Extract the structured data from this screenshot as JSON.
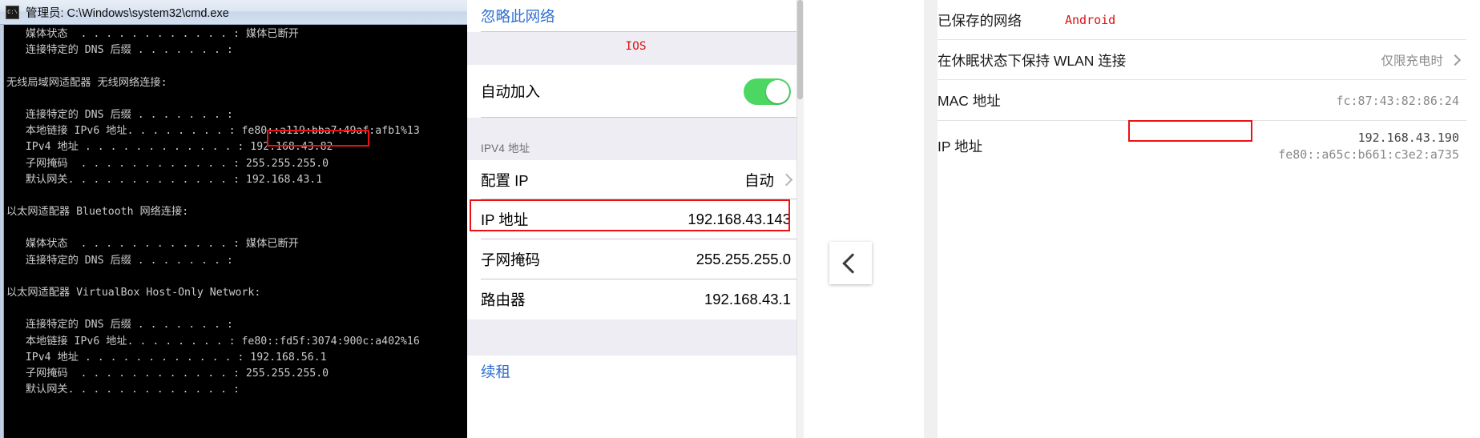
{
  "cmd": {
    "icon_label": "C:\\",
    "title": "管理员: C:\\Windows\\system32\\cmd.exe",
    "lines": [
      "   媒体状态  . . . . . . . . . . . . : 媒体已断开",
      "   连接特定的 DNS 后缀 . . . . . . . :",
      "",
      "无线局域网适配器 无线网络连接:",
      "",
      "   连接特定的 DNS 后缀 . . . . . . . :",
      "   本地链接 IPv6 地址. . . . . . . . : fe80::a119:bba7:49af:afb1%13",
      "   IPv4 地址 . . . . . . . . . . . . : 192.168.43.82",
      "   子网掩码  . . . . . . . . . . . . : 255.255.255.0",
      "   默认网关. . . . . . . . . . . . . : 192.168.43.1",
      "",
      "以太网适配器 Bluetooth 网络连接:",
      "",
      "   媒体状态  . . . . . . . . . . . . : 媒体已断开",
      "   连接特定的 DNS 后缀 . . . . . . . :",
      "",
      "以太网适配器 VirtualBox Host-Only Network:",
      "",
      "   连接特定的 DNS 后缀 . . . . . . . :",
      "   本地链接 IPv6 地址. . . . . . . . : fe80::fd5f:3074:900c:a402%16",
      "   IPv4 地址 . . . . . . . . . . . . : 192.168.56.1",
      "   子网掩码  . . . . . . . . . . . . : 255.255.255.0",
      "   默认网关. . . . . . . . . . . . . :"
    ],
    "highlight_value": "192.168.43.82"
  },
  "ios": {
    "forget_network": "忽略此网络",
    "annotation": "IOS",
    "auto_join_label": "自动加入",
    "auto_join_on": true,
    "ipv4_group_header": "IPV4 地址",
    "rows": [
      {
        "label": "配置 IP",
        "value": "自动",
        "chevron": true
      },
      {
        "label": "IP 地址",
        "value": "192.168.43.143",
        "chevron": false
      },
      {
        "label": "子网掩码",
        "value": "255.255.255.0",
        "chevron": false
      },
      {
        "label": "路由器",
        "value": "192.168.43.1",
        "chevron": false
      }
    ],
    "renew_lease": "续租",
    "highlight_row_label": "IP 地址"
  },
  "android": {
    "saved_network_label": "已保存的网络",
    "annotation": "Android",
    "rows": [
      {
        "label": "在休眠状态下保持 WLAN 连接",
        "value": "仅限充电时",
        "chevron": true
      },
      {
        "label": "MAC 地址",
        "value": "fc:87:43:82:86:24",
        "chevron": false
      },
      {
        "label": "IP 地址",
        "value": "192.168.43.190",
        "value2": "fe80::a65c:b661:c3e2:a735",
        "chevron": false
      }
    ],
    "highlight_value": "192.168.43.190"
  },
  "back_button": {
    "icon": "chevron-left"
  },
  "colors": {
    "annotation_red": "#dd1111",
    "highlight_red": "#ee1111",
    "ios_link_blue": "#2f6fd0",
    "toggle_green": "#4cd763"
  }
}
